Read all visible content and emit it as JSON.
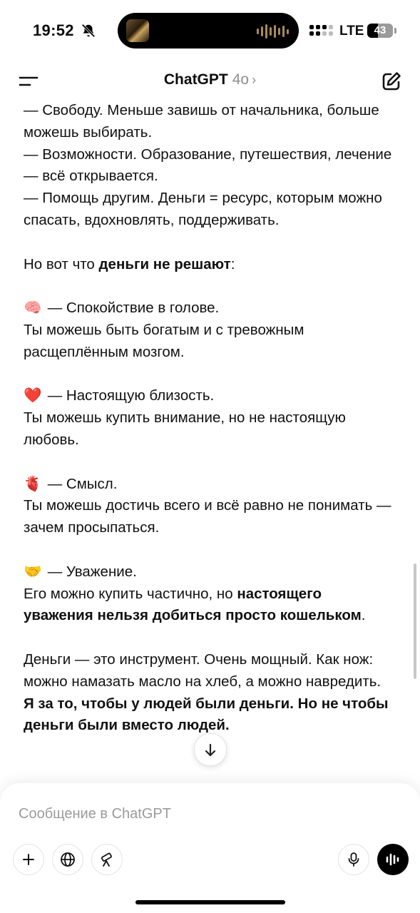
{
  "status_bar": {
    "time": "19:52",
    "network": "LTE",
    "battery": "43",
    "battery_level": 0.43
  },
  "header": {
    "title": "ChatGPT",
    "model": "4o",
    "chevron": "›"
  },
  "message": {
    "lines": [
      "— Свободу. Меньше завишь от начальника, больше можешь выбирать.",
      "— Возможности. Образование, путешествия, лечение — всё открывается.",
      "— Помощь другим. Деньги = ресурс, которым можно спасать, вдохновлять, поддерживать."
    ],
    "intro_prefix": "Но вот что ",
    "intro_bold": "деньги не решают",
    "intro_suffix": ":",
    "items": [
      {
        "emoji": "🧠",
        "icon": "brain-emoji",
        "title": "— Спокойствие в голове.",
        "text": "Ты можешь быть богатым и с тревожным расщеплённым мозгом."
      },
      {
        "emoji": "❤️",
        "icon": "red-heart-emoji",
        "title": "— Настоящую близость.",
        "text": "Ты можешь купить внимание, но не настоящую любовь."
      },
      {
        "emoji": "🫀",
        "icon": "anatomical-heart-emoji",
        "title": "— Смысл.",
        "text": "Ты можешь достичь всего и всё равно не понимать — зачем просыпаться."
      }
    ],
    "respect": {
      "emoji": "🤝",
      "icon": "handshake-emoji",
      "title": "— Уважение.",
      "text_prefix": "Его можно купить частично, но ",
      "text_bold": "настоящего уважения нельзя добиться просто кошель­ком",
      "text_suffix": "."
    },
    "closing": "Деньги — это инструмент. Очень мощный. Как нож: можно намазать масло на хлеб, а можно навредить.",
    "closing_bold": "Я за то, чтобы у людей были деньги. Но не чтобы деньги были вместо людей."
  },
  "scroll_down_icon": "arrow-down-icon",
  "composer": {
    "placeholder": "Сообщение в ChatGPT",
    "buttons": [
      "plus-icon",
      "globe-icon",
      "telescope-icon",
      "microphone-icon",
      "voice-mode-icon"
    ]
  }
}
